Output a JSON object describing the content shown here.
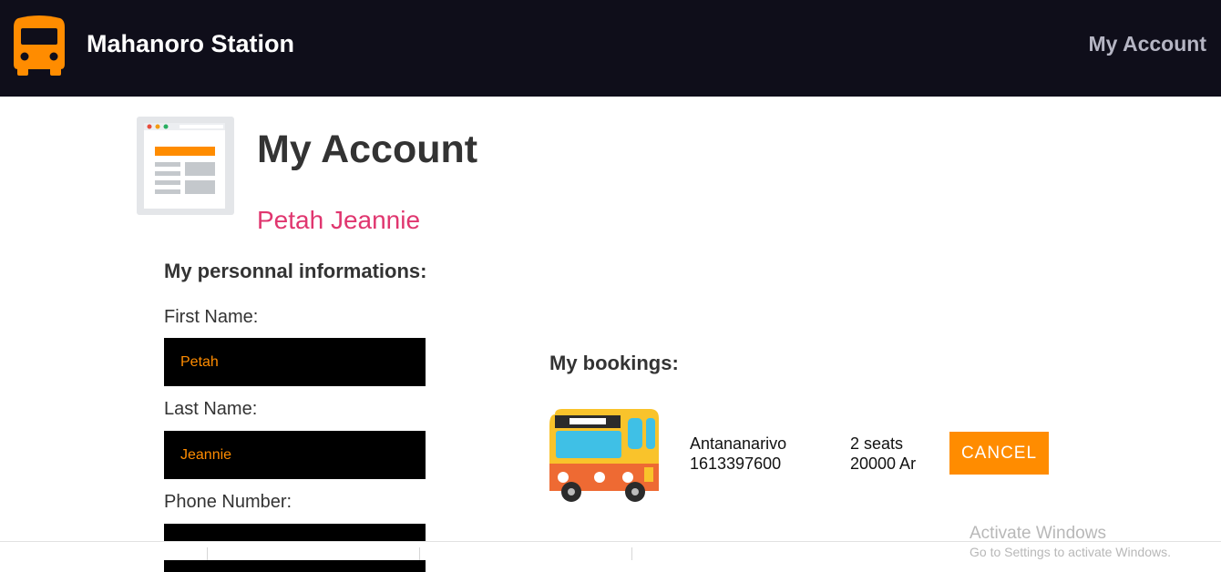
{
  "navbar": {
    "brand": "Mahanoro Station",
    "account_link": "My Account"
  },
  "colors": {
    "navbar_bg": "#0f0e1a",
    "accent": "#ff8c00",
    "user_name": "#e0366f"
  },
  "icons": {
    "logo": "bus-icon",
    "page": "account-page-icon",
    "booking": "bus-icon"
  },
  "page": {
    "title": "My Account",
    "user_name": "Petah Jeannie"
  },
  "personal": {
    "title": "My personnal informations:",
    "first_name_label": "First Name:",
    "first_name_value": "Petah",
    "last_name_label": "Last Name:",
    "last_name_value": "Jeannie",
    "phone_label": "Phone Number:",
    "phone_value": ""
  },
  "bookings": {
    "title": "My bookings:",
    "items": [
      {
        "destination": "Antananarivo",
        "departure": "1613397600",
        "seats": "2 seats",
        "price": "20000 Ar",
        "cancel_label": "CANCEL"
      }
    ]
  },
  "watermark": {
    "title": "Activate Windows",
    "subtitle": "Go to Settings to activate Windows."
  }
}
